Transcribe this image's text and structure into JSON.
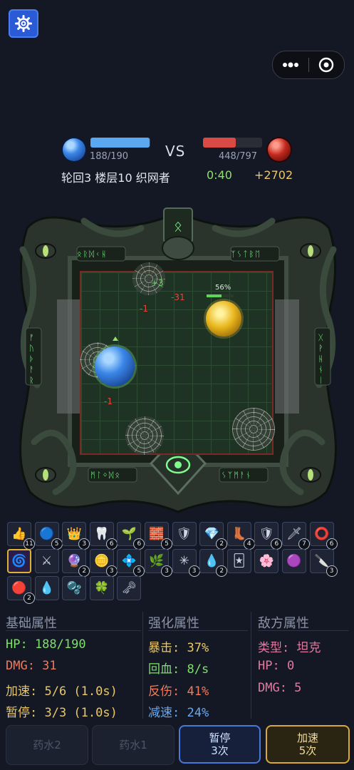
{
  "hud": {
    "player_hp": "188/190",
    "player_hp_fraction": 0.99,
    "vs": "VS",
    "enemy_hp": "448/797",
    "enemy_hp_fraction": 0.56,
    "info": "轮回3 楼层10 织网者",
    "timer": "0:40",
    "gold": "+2702"
  },
  "arena": {
    "enemy_progress": "56%",
    "float_heal": "+3",
    "float_dmg_1": "-31",
    "float_dmg_2": "-1",
    "float_dmg_3": "-1",
    "left_runes": "ᚠᚢᚦᚨᚱ",
    "right_runes": "ᚷᚹᚺᚾᛁ",
    "top_left_runes": "ᛟᚱᛞᚲᚺ",
    "top_right_runes": "ᛉᛊᛏᛒᛖ",
    "bot_left_runes": "ᛗᛚᛜᛞᛟ",
    "bot_right_runes": "ᛊᛉᛗᚨᚾ"
  },
  "items": [
    {
      "icon": "thumbs-up-icon",
      "glyph": "👍",
      "count": "11"
    },
    {
      "icon": "blue-orb-icon",
      "glyph": "🔵",
      "count": "5"
    },
    {
      "icon": "crown-icon",
      "glyph": "👑",
      "count": "3"
    },
    {
      "icon": "fang-icon",
      "glyph": "🦷",
      "count": "6"
    },
    {
      "icon": "sprout-icon",
      "glyph": "🌱",
      "count": "6"
    },
    {
      "icon": "stone-block-icon",
      "glyph": "🧱",
      "count": "5"
    },
    {
      "icon": "tank-icon",
      "glyph": "🛡",
      "count": ""
    },
    {
      "icon": "gem-icon",
      "glyph": "💎",
      "count": "2"
    },
    {
      "icon": "boot-icon",
      "glyph": "👢",
      "count": "4"
    },
    {
      "icon": "shield-icon",
      "glyph": "🛡",
      "count": "6"
    },
    {
      "icon": "sword-icon",
      "glyph": "🗡",
      "count": "7"
    },
    {
      "icon": "ring-icon",
      "glyph": "⭕",
      "count": "6"
    },
    {
      "icon": "spark-orb-icon",
      "glyph": "🌀",
      "count": "",
      "selected": true
    },
    {
      "icon": "crossed-swords-icon",
      "glyph": "⚔",
      "count": ""
    },
    {
      "icon": "magic-orb-icon",
      "glyph": "🔮",
      "count": "2"
    },
    {
      "icon": "coin-icon",
      "glyph": "🪙",
      "count": "3"
    },
    {
      "icon": "crystal-icon",
      "glyph": "💠",
      "count": "5"
    },
    {
      "icon": "herb-icon",
      "glyph": "🌿",
      "count": "3"
    },
    {
      "icon": "starburst-icon",
      "glyph": "✳",
      "count": "3"
    },
    {
      "icon": "water-drop-icon",
      "glyph": "💧",
      "count": "2"
    },
    {
      "icon": "drop-card-icon",
      "glyph": "🃏",
      "count": ""
    },
    {
      "icon": "lotus-icon",
      "glyph": "🌸",
      "count": ""
    },
    {
      "icon": "pink-pearl-icon",
      "glyph": "🟣",
      "count": ""
    },
    {
      "icon": "dagger-icon",
      "glyph": "🔪",
      "count": "3"
    },
    {
      "icon": "red-mine-icon",
      "glyph": "🔴",
      "count": "2"
    },
    {
      "icon": "small-drop-icon",
      "glyph": "💧",
      "count": ""
    },
    {
      "icon": "blue-bubble-icon",
      "glyph": "🫧",
      "count": ""
    },
    {
      "icon": "clover-icon",
      "glyph": "🍀",
      "count": ""
    },
    {
      "icon": "key-icon",
      "glyph": "🗝",
      "count": ""
    }
  ],
  "stats": {
    "basic": {
      "title": "基础属性",
      "hp": "HP: 188/190",
      "dmg": "DMG: 31",
      "speed": "加速: 5/6 (1.0s)",
      "pause": "暂停: 3/3 (1.0s)"
    },
    "enhance": {
      "title": "强化属性",
      "crit": "暴击: 37%",
      "regen": "回血: 8/s",
      "reflect": "反伤: 41%",
      "slow": "减速: 24%"
    },
    "enemy": {
      "title": "敌方属性",
      "type": "类型: 坦克",
      "hp": "HP: 0",
      "dmg": "DMG: 5"
    }
  },
  "buttons": {
    "potion2": "药水2",
    "potion1": "药水1",
    "pause_title": "暂停",
    "pause_count": "3次",
    "speed_title": "加速",
    "speed_count": "5次"
  },
  "colors": {
    "accent_blue": "#5aa8f0",
    "enemy_red": "#d94a45",
    "gold": "#e9c86a",
    "green": "#8fe06a"
  }
}
